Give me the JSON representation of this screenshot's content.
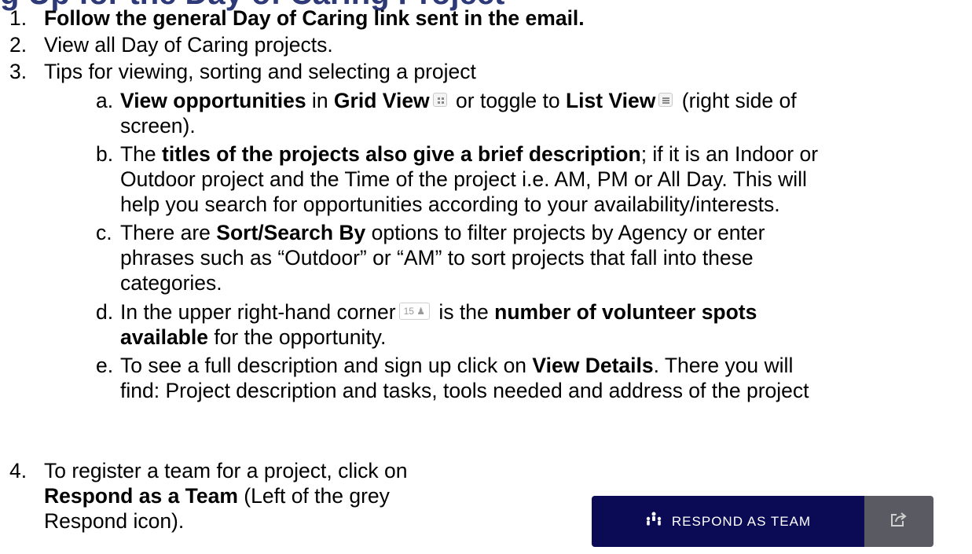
{
  "heading": "g Up for the Day of Caring Project",
  "items": {
    "i1": {
      "num": "1.",
      "text": "Follow the general Day of Caring link sent in the email."
    },
    "i2": {
      "num": "2.",
      "text": "View all Day of Caring projects."
    },
    "i3": {
      "num": "3.",
      "text": "Tips for viewing, sorting and selecting a project"
    },
    "a": {
      "letter": "a.",
      "b1": "View opportunities",
      "t1": " in ",
      "b2": "Grid View",
      "t2": " or toggle to ",
      "b3": "List View",
      "t3": " (right side of",
      "line2": "screen)."
    },
    "b": {
      "letter": "b.",
      "t0": "The ",
      "b1": "titles of the projects also give a brief description",
      "t1": "; if it is an Indoor or",
      "line2": "Outdoor project and the Time of the project i.e. AM, PM or All Day. This will",
      "line3": "help you search for opportunities according to your availability/interests."
    },
    "c": {
      "letter": "c.",
      "t0": "There are ",
      "b1": "Sort/Search By",
      "t1": " options to filter projects by Agency or enter",
      "line2": "phrases such as “Outdoor” or “AM” to sort projects that fall into these",
      "line3": "categories."
    },
    "d": {
      "letter": "d.",
      "t0": "In the upper right-hand corner",
      "badge": "15 ♟",
      "t1": " is the ",
      "b1": "number of volunteer spots",
      "line2": "available",
      "line2_rest": " for the opportunity."
    },
    "e": {
      "letter": "e.",
      "t0": "To see a full description and sign up click on ",
      "b1": "View Details",
      "t1": ". There you will",
      "line2": "find: Project description and tasks, tools needed and address of the project"
    },
    "i4": {
      "num": "4.",
      "line1": "To register a team for a project, click on",
      "line2_bold": "Respond as a Team",
      "line2_rest": " (Left of the grey",
      "line3": "Respond icon)."
    }
  },
  "button": {
    "label": "RESPOND AS TEAM",
    "icon": "team-icon",
    "share_icon": "share-icon",
    "colors": {
      "primary": "#0b0b55",
      "secondary": "#5a5a62"
    }
  }
}
